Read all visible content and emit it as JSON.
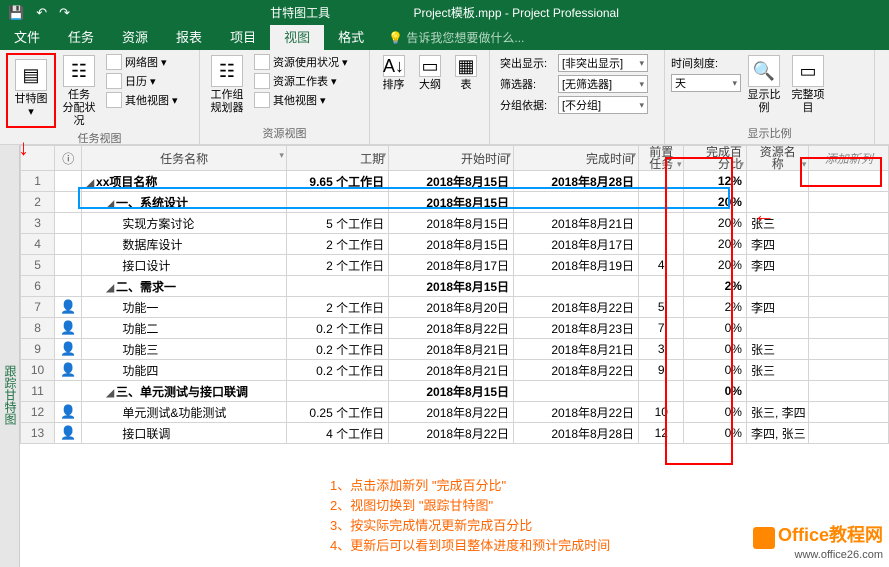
{
  "titlebar": {
    "tools_label": "甘特图工具",
    "filename": "Project模板.mpp - Project Professional"
  },
  "tabs": {
    "file": "文件",
    "task": "任务",
    "resource": "资源",
    "report": "报表",
    "project": "项目",
    "view": "视图",
    "format": "格式",
    "tellme": "告诉我您想要做什么..."
  },
  "ribbon": {
    "gantt": {
      "label": "甘特图"
    },
    "taskusage": {
      "label": "任务\n分配状况"
    },
    "network": "网络图",
    "calendar": "日历",
    "otherview": "其他视图",
    "group1": "任务视图",
    "teamplanner": {
      "label": "工作组\n规划器"
    },
    "res_usage": "资源使用状况",
    "res_sheet": "资源工作表",
    "res_other": "其他视图",
    "group2": "资源视图",
    "sort": "排序",
    "outline": "大纲",
    "tables": "表",
    "highlight": "突出显示:",
    "highlight_v": "[非突出显示]",
    "filter": "筛选器:",
    "filter_v": "[无筛选器]",
    "groupby": "分组依据:",
    "groupby_v": "[不分组]",
    "timescale": "时间刻度:",
    "timescale_v": "天",
    "zoom": "显示比例",
    "wholeproj": "完整项目",
    "group3": "显示比例"
  },
  "columns": {
    "info": "ⓘ",
    "name": "任务名称",
    "dur": "工期",
    "start": "开始时间",
    "finish": "完成时间",
    "pred": "前置\n任务",
    "pct": "完成百\n分比",
    "res": "资源名\n称",
    "new": "添加新列"
  },
  "rows": [
    {
      "n": "1",
      "i": "",
      "name": "xx项目名称",
      "ind": 0,
      "sum": true,
      "dur": "9.65 个工作日",
      "start": "2018年8月15日",
      "finish": "2018年8月28日",
      "pred": "",
      "pct": "12%",
      "res": ""
    },
    {
      "n": "2",
      "i": "",
      "name": "一、系统设计",
      "ind": 1,
      "sum": true,
      "dur": "",
      "start": "2018年8月15日",
      "finish": "",
      "pred": "",
      "pct": "20%",
      "res": ""
    },
    {
      "n": "3",
      "i": "",
      "name": "实现方案讨论",
      "ind": 2,
      "dur": "5 个工作日",
      "start": "2018年8月15日",
      "finish": "2018年8月21日",
      "pred": "",
      "pct": "20%",
      "res": "张三"
    },
    {
      "n": "4",
      "i": "",
      "name": "数据库设计",
      "ind": 2,
      "dur": "2 个工作日",
      "start": "2018年8月15日",
      "finish": "2018年8月17日",
      "pred": "",
      "pct": "20%",
      "res": "李四"
    },
    {
      "n": "5",
      "i": "",
      "name": "接口设计",
      "ind": 2,
      "dur": "2 个工作日",
      "start": "2018年8月17日",
      "finish": "2018年8月19日",
      "pred": "4",
      "pct": "20%",
      "res": "李四"
    },
    {
      "n": "6",
      "i": "",
      "name": "二、需求一",
      "ind": 1,
      "sum": true,
      "dur": "",
      "start": "2018年8月15日",
      "finish": "",
      "pred": "",
      "pct": "2%",
      "res": ""
    },
    {
      "n": "7",
      "i": "p",
      "name": "功能一",
      "ind": 2,
      "dur": "2 个工作日",
      "start": "2018年8月20日",
      "finish": "2018年8月22日",
      "pred": "5",
      "pct": "2%",
      "res": "李四"
    },
    {
      "n": "8",
      "i": "p",
      "name": "功能二",
      "ind": 2,
      "dur": "0.2 个工作日",
      "start": "2018年8月22日",
      "finish": "2018年8月23日",
      "pred": "7",
      "pct": "0%",
      "res": ""
    },
    {
      "n": "9",
      "i": "p",
      "name": "功能三",
      "ind": 2,
      "dur": "0.2 个工作日",
      "start": "2018年8月21日",
      "finish": "2018年8月21日",
      "pred": "3",
      "pct": "0%",
      "res": "张三"
    },
    {
      "n": "10",
      "i": "p",
      "name": "功能四",
      "ind": 2,
      "dur": "0.2 个工作日",
      "start": "2018年8月21日",
      "finish": "2018年8月22日",
      "pred": "9",
      "pct": "0%",
      "res": "张三"
    },
    {
      "n": "11",
      "i": "",
      "name": "三、单元测试与接口联调",
      "ind": 1,
      "sum": true,
      "dur": "",
      "start": "2018年8月15日",
      "finish": "",
      "pred": "",
      "pct": "0%",
      "res": ""
    },
    {
      "n": "12",
      "i": "p",
      "name": "单元测试&功能测试",
      "ind": 2,
      "dur": "0.25 个工作日",
      "start": "2018年8月22日",
      "finish": "2018年8月22日",
      "pred": "10",
      "pct": "0%",
      "res": "张三, 李四"
    },
    {
      "n": "13",
      "i": "p",
      "name": "接口联调",
      "ind": 2,
      "dur": "4 个工作日",
      "start": "2018年8月22日",
      "finish": "2018年8月28日",
      "pred": "12",
      "pct": "0%",
      "res": "李四, 张三"
    }
  ],
  "notes": {
    "l1": "1、点击添加新列 \"完成百分比\"",
    "l2": "2、视图切换到 \"跟踪甘特图\"",
    "l3": "3、按实际完成情况更新完成百分比",
    "l4": "4、更新后可以看到项目整体进度和预计完成时间"
  },
  "sidebar": "跟踪甘特图",
  "watermark": {
    "brand": "Office教程网",
    "url": "www.office26.com"
  }
}
